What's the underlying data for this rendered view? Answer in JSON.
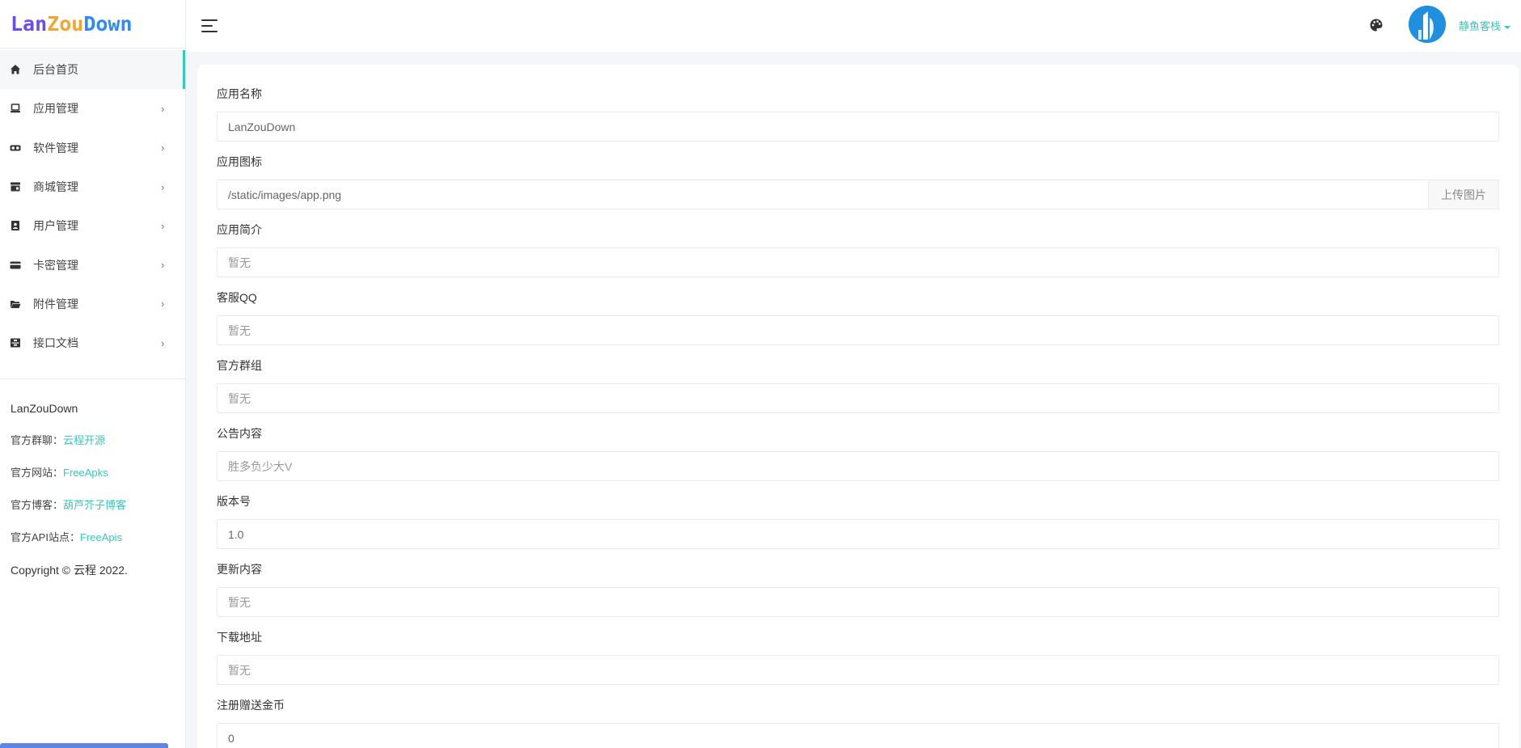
{
  "logo": {
    "part_a": "Lan",
    "part_b": "Zou",
    "part_c": "Down"
  },
  "sidebar": {
    "items": [
      {
        "label": "后台首页",
        "icon": "home-icon"
      },
      {
        "label": "应用管理",
        "icon": "laptop-icon"
      },
      {
        "label": "软件管理",
        "icon": "glasses-icon"
      },
      {
        "label": "商城管理",
        "icon": "store-icon"
      },
      {
        "label": "用户管理",
        "icon": "user-badge-icon"
      },
      {
        "label": "卡密管理",
        "icon": "card-icon"
      },
      {
        "label": "附件管理",
        "icon": "folder-icon"
      },
      {
        "label": "接口文档",
        "icon": "archive-icon"
      }
    ],
    "info": {
      "brand": "LanZouDown",
      "group_label": "官方群聊：",
      "group_link": "云程开源",
      "site_label": "官方网站：",
      "site_link": "FreeApks",
      "blog_label": "官方博客：",
      "blog_link": "葫芦芥子博客",
      "api_label": "官方API站点：",
      "api_link": "FreeApis",
      "copyright": "Copyright © 云程 2022."
    }
  },
  "header": {
    "username": "静鱼客栈"
  },
  "form": {
    "app_name": {
      "label": "应用名称",
      "value": "LanZouDown"
    },
    "app_icon": {
      "label": "应用图标",
      "value": "/static/images/app.png",
      "button": "上传图片"
    },
    "app_intro": {
      "label": "应用简介",
      "value": "暂无"
    },
    "service_qq": {
      "label": "客服QQ",
      "value": "暂无"
    },
    "official_group": {
      "label": "官方群组",
      "value": "暂无"
    },
    "notice": {
      "label": "公告内容",
      "value": "胜多负少大V"
    },
    "version": {
      "label": "版本号",
      "value": "1.0"
    },
    "update_content": {
      "label": "更新内容",
      "value": "暂无"
    },
    "download_url": {
      "label": "下载地址",
      "value": "暂无"
    },
    "register_coins": {
      "label": "注册赠送金币",
      "value": "0"
    }
  }
}
